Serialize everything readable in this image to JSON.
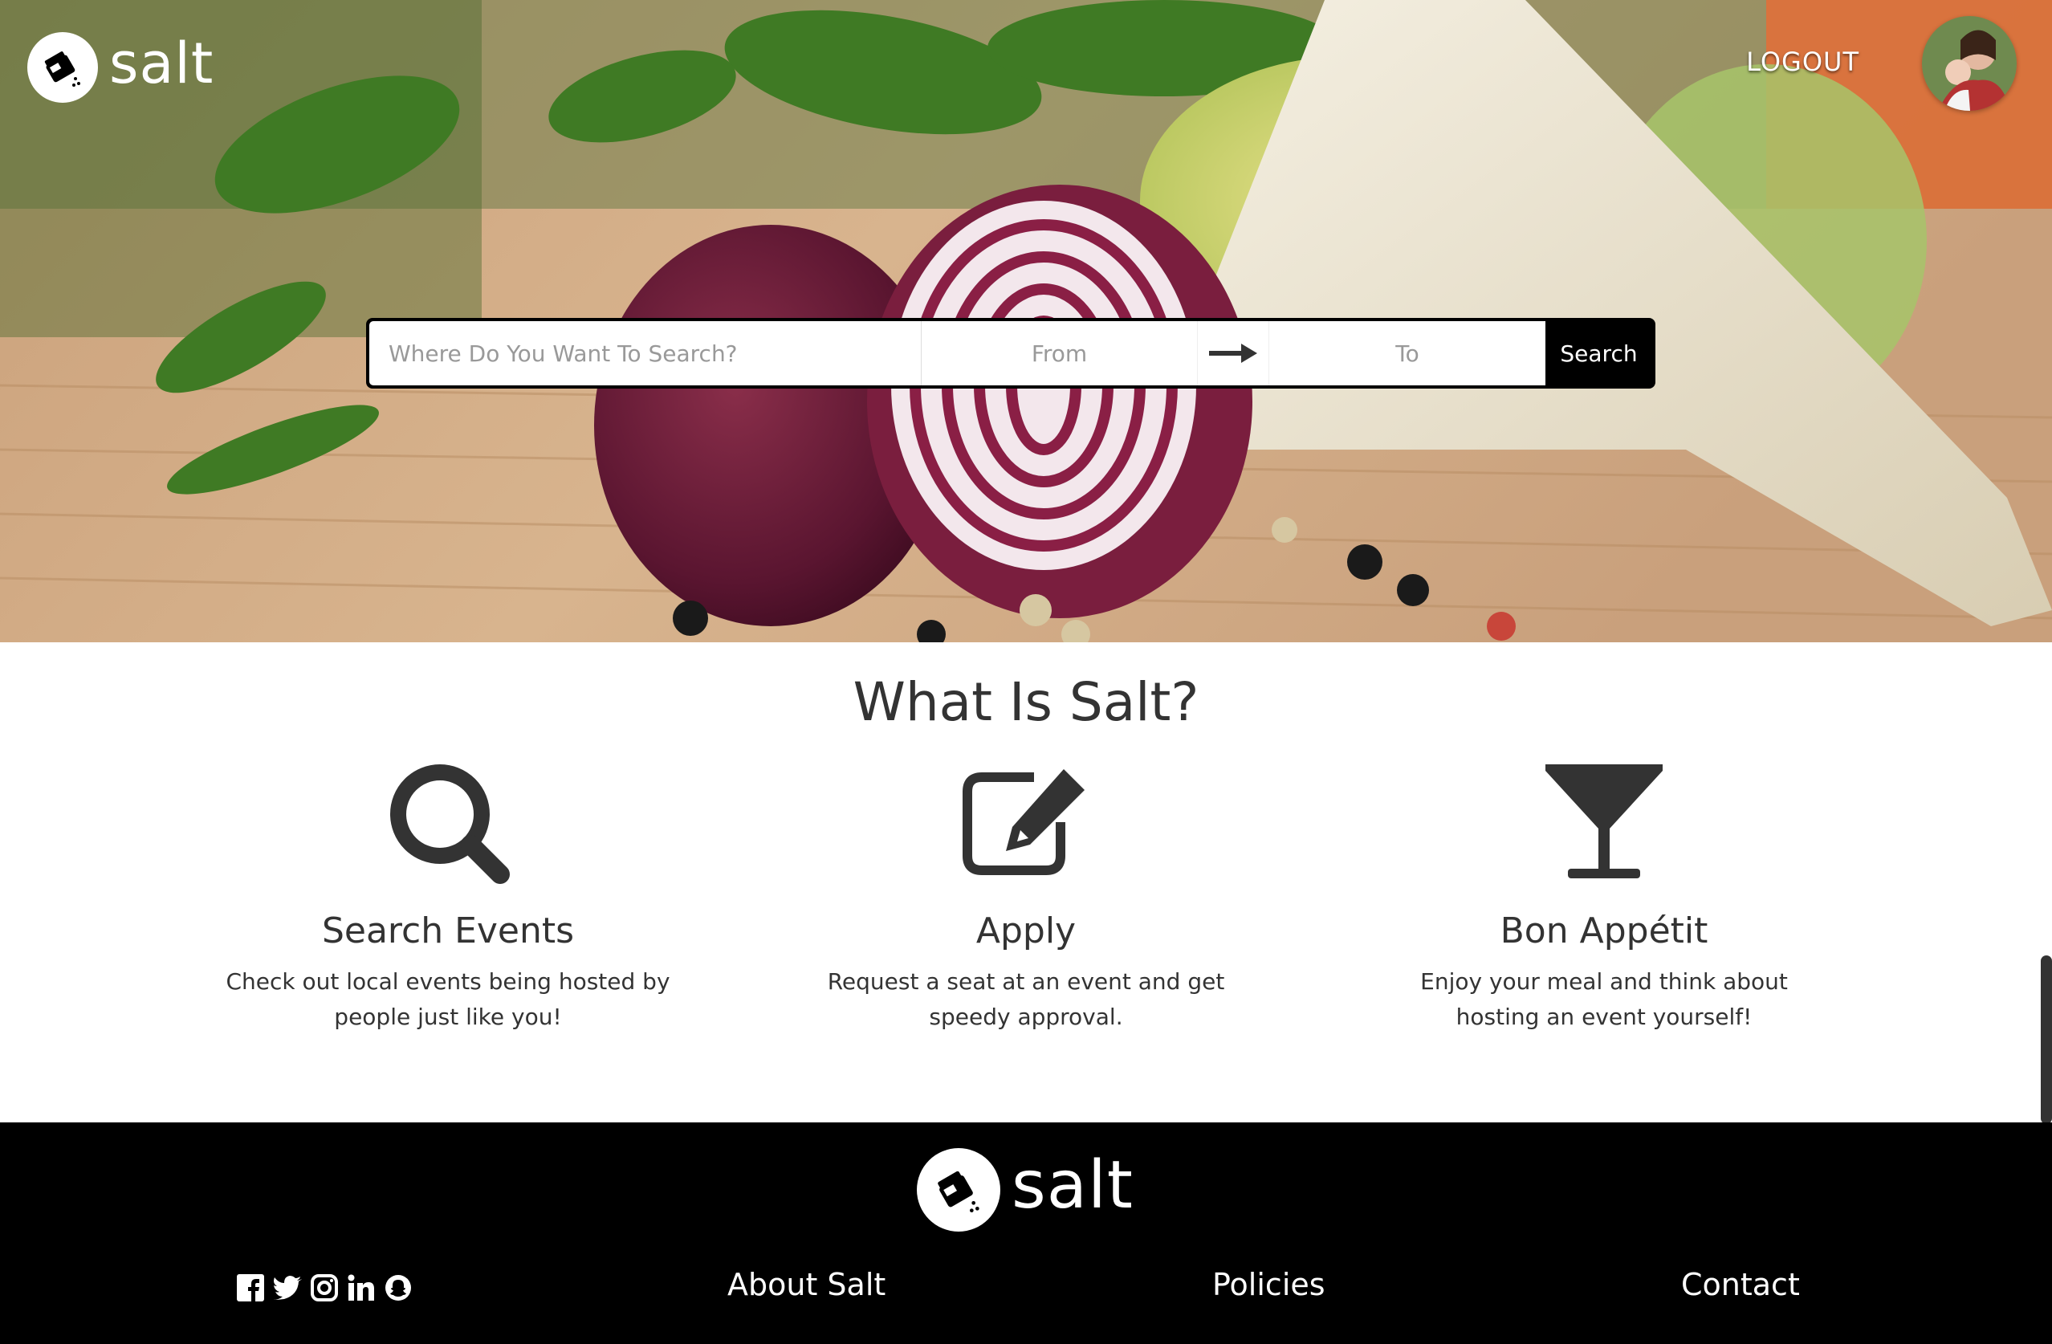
{
  "brand": {
    "name": "salt"
  },
  "header": {
    "logout_label": "LOGOUT"
  },
  "search": {
    "where_placeholder": "Where Do You Want To Search?",
    "from_placeholder": "From",
    "to_placeholder": "To",
    "button_label": "Search",
    "arrow_icon": "arrow-right-icon"
  },
  "about": {
    "title": "What Is Salt?",
    "features": [
      {
        "icon": "search-icon",
        "title": "Search Events",
        "description": "Check out local events being hosted by people just like you!"
      },
      {
        "icon": "edit-icon",
        "title": "Apply",
        "description": "Request a seat at an event and get speedy approval."
      },
      {
        "icon": "cocktail-glass-icon",
        "title": "Bon Appétit",
        "description": "Enjoy your meal and think about hosting an event yourself!"
      }
    ]
  },
  "footer": {
    "brand_name": "salt",
    "socials": [
      "facebook-icon",
      "twitter-icon",
      "instagram-icon",
      "linkedin-icon",
      "snapchat-icon"
    ],
    "links": {
      "about": "About Salt",
      "policies": "Policies",
      "contact": "Contact"
    }
  },
  "colors": {
    "footer_bg": "#000000",
    "text_dark": "#333333",
    "search_button_bg": "#000000"
  }
}
